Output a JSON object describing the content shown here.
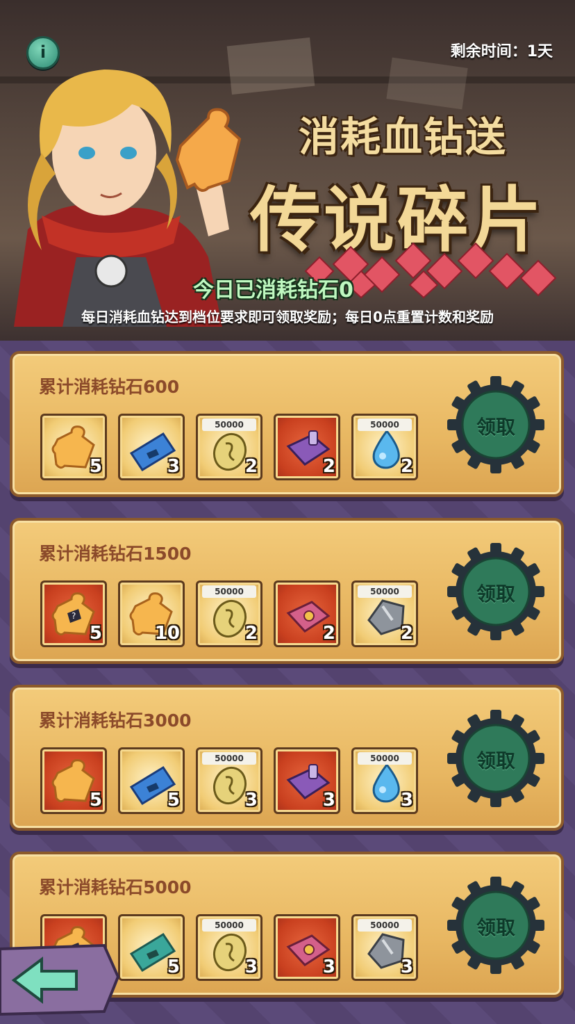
{
  "header": {
    "remaining_time": "剩余时间：1天",
    "title_line1": "消耗血钻送",
    "title_line2": "传说碎片",
    "consumed_today": "今日已消耗钻石0",
    "rules": "每日消耗血钻达到档位要求即可领取奖励；每日0点重置计数和奖励"
  },
  "info_icon": "i",
  "tiers": [
    {
      "title": "累计消耗钻石600",
      "button": "领取",
      "items": [
        {
          "icon": "puzzle-piece-icon",
          "bg": "gold",
          "count": "5"
        },
        {
          "icon": "ticket-icon",
          "bg": "gold",
          "count": "3"
        },
        {
          "icon": "gold-coin-icon",
          "bg": "gold",
          "amount": "50000",
          "count": "2"
        },
        {
          "icon": "skill-book-icon",
          "bg": "red",
          "count": "2"
        },
        {
          "icon": "water-drop-icon",
          "bg": "gold",
          "amount": "50000",
          "count": "2"
        }
      ]
    },
    {
      "title": "累计消耗钻石1500",
      "button": "领取",
      "items": [
        {
          "icon": "mystery-puzzle-icon",
          "bg": "red",
          "count": "5"
        },
        {
          "icon": "puzzle-piece-icon",
          "bg": "gold",
          "count": "10"
        },
        {
          "icon": "gold-coin-icon",
          "bg": "gold",
          "amount": "50000",
          "count": "2"
        },
        {
          "icon": "pink-book-icon",
          "bg": "red",
          "count": "2"
        },
        {
          "icon": "ore-stone-icon",
          "bg": "gold",
          "amount": "50000",
          "count": "2"
        }
      ]
    },
    {
      "title": "累计消耗钻石3000",
      "button": "领取",
      "items": [
        {
          "icon": "puzzle-piece-icon",
          "bg": "red",
          "count": "5"
        },
        {
          "icon": "ticket-icon",
          "bg": "gold",
          "count": "5"
        },
        {
          "icon": "gold-coin-icon",
          "bg": "gold",
          "amount": "50000",
          "count": "3"
        },
        {
          "icon": "skill-book-icon",
          "bg": "red",
          "count": "3"
        },
        {
          "icon": "water-drop-icon",
          "bg": "gold",
          "amount": "50000",
          "count": "3"
        }
      ]
    },
    {
      "title": "累计消耗钻石5000",
      "button": "领取",
      "items": [
        {
          "icon": "mystery-puzzle-icon",
          "bg": "red",
          "count": ""
        },
        {
          "icon": "green-ticket-icon",
          "bg": "gold",
          "count": "5"
        },
        {
          "icon": "gold-coin-icon",
          "bg": "gold",
          "amount": "50000",
          "count": "3"
        },
        {
          "icon": "pink-book-icon",
          "bg": "red",
          "count": "3"
        },
        {
          "icon": "ore-stone-icon",
          "bg": "gold",
          "amount": "50000",
          "count": "3"
        }
      ]
    }
  ],
  "colors": {
    "panel": "#e8b762",
    "panel_border": "#8c5a2b",
    "tier_title": "#8b4a2a",
    "claim_button": "#2f7a5a",
    "gear": "#26323a",
    "consumed_text": "#bff8c0"
  }
}
